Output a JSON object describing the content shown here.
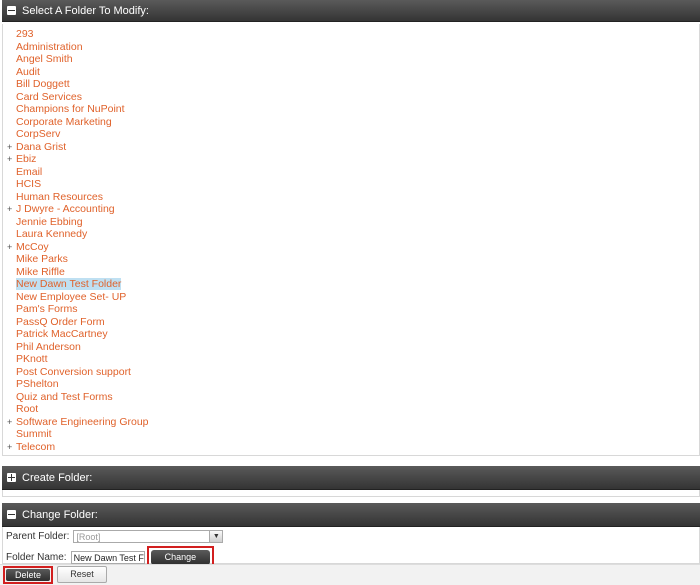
{
  "select_panel": {
    "title": "Select A Folder To Modify:",
    "folders": [
      {
        "label": "293",
        "expandable": false,
        "selected": false
      },
      {
        "label": "Administration",
        "expandable": false,
        "selected": false
      },
      {
        "label": "Angel Smith",
        "expandable": false,
        "selected": false
      },
      {
        "label": "Audit",
        "expandable": false,
        "selected": false
      },
      {
        "label": "Bill Doggett",
        "expandable": false,
        "selected": false
      },
      {
        "label": "Card Services",
        "expandable": false,
        "selected": false
      },
      {
        "label": "Champions for NuPoint",
        "expandable": false,
        "selected": false
      },
      {
        "label": "Corporate Marketing",
        "expandable": false,
        "selected": false
      },
      {
        "label": "CorpServ",
        "expandable": false,
        "selected": false
      },
      {
        "label": "Dana Grist",
        "expandable": true,
        "selected": false
      },
      {
        "label": "Ebiz",
        "expandable": true,
        "selected": false
      },
      {
        "label": "Email",
        "expandable": false,
        "selected": false
      },
      {
        "label": "HCIS",
        "expandable": false,
        "selected": false
      },
      {
        "label": "Human Resources",
        "expandable": false,
        "selected": false
      },
      {
        "label": "J Dwyre - Accounting",
        "expandable": true,
        "selected": false
      },
      {
        "label": "Jennie Ebbing",
        "expandable": false,
        "selected": false
      },
      {
        "label": "Laura Kennedy",
        "expandable": false,
        "selected": false
      },
      {
        "label": "McCoy",
        "expandable": true,
        "selected": false
      },
      {
        "label": "Mike Parks",
        "expandable": false,
        "selected": false
      },
      {
        "label": "Mike Riffle",
        "expandable": false,
        "selected": false
      },
      {
        "label": "New Dawn Test Folder",
        "expandable": false,
        "selected": true
      },
      {
        "label": "New Employee Set- UP",
        "expandable": false,
        "selected": false
      },
      {
        "label": "Pam's Forms",
        "expandable": false,
        "selected": false
      },
      {
        "label": "PassQ Order Form",
        "expandable": false,
        "selected": false
      },
      {
        "label": "Patrick MacCartney",
        "expandable": false,
        "selected": false
      },
      {
        "label": "Phil Anderson",
        "expandable": false,
        "selected": false
      },
      {
        "label": "PKnott",
        "expandable": false,
        "selected": false
      },
      {
        "label": "Post Conversion support",
        "expandable": false,
        "selected": false
      },
      {
        "label": "PShelton",
        "expandable": false,
        "selected": false
      },
      {
        "label": "Quiz and Test Forms",
        "expandable": false,
        "selected": false
      },
      {
        "label": "Root",
        "expandable": false,
        "selected": false
      },
      {
        "label": "Software Engineering Group",
        "expandable": true,
        "selected": false
      },
      {
        "label": "Summit",
        "expandable": false,
        "selected": false
      },
      {
        "label": "Telecom",
        "expandable": true,
        "selected": false
      }
    ]
  },
  "create_panel": {
    "title": "Create Folder:"
  },
  "change_panel": {
    "title": "Change Folder:",
    "parent_label": "Parent Folder:",
    "parent_value": "[Root]",
    "name_label": "Folder Name:",
    "name_value": "New Dawn Test Folder",
    "change_button": "Change"
  },
  "footer": {
    "delete_button": "Delete",
    "reset_button": "Reset"
  },
  "colors": {
    "link": "#e0622b",
    "header": "#3f3f3f",
    "selected_highlight": "#bfe0f2",
    "callout": "#d21f1f"
  }
}
